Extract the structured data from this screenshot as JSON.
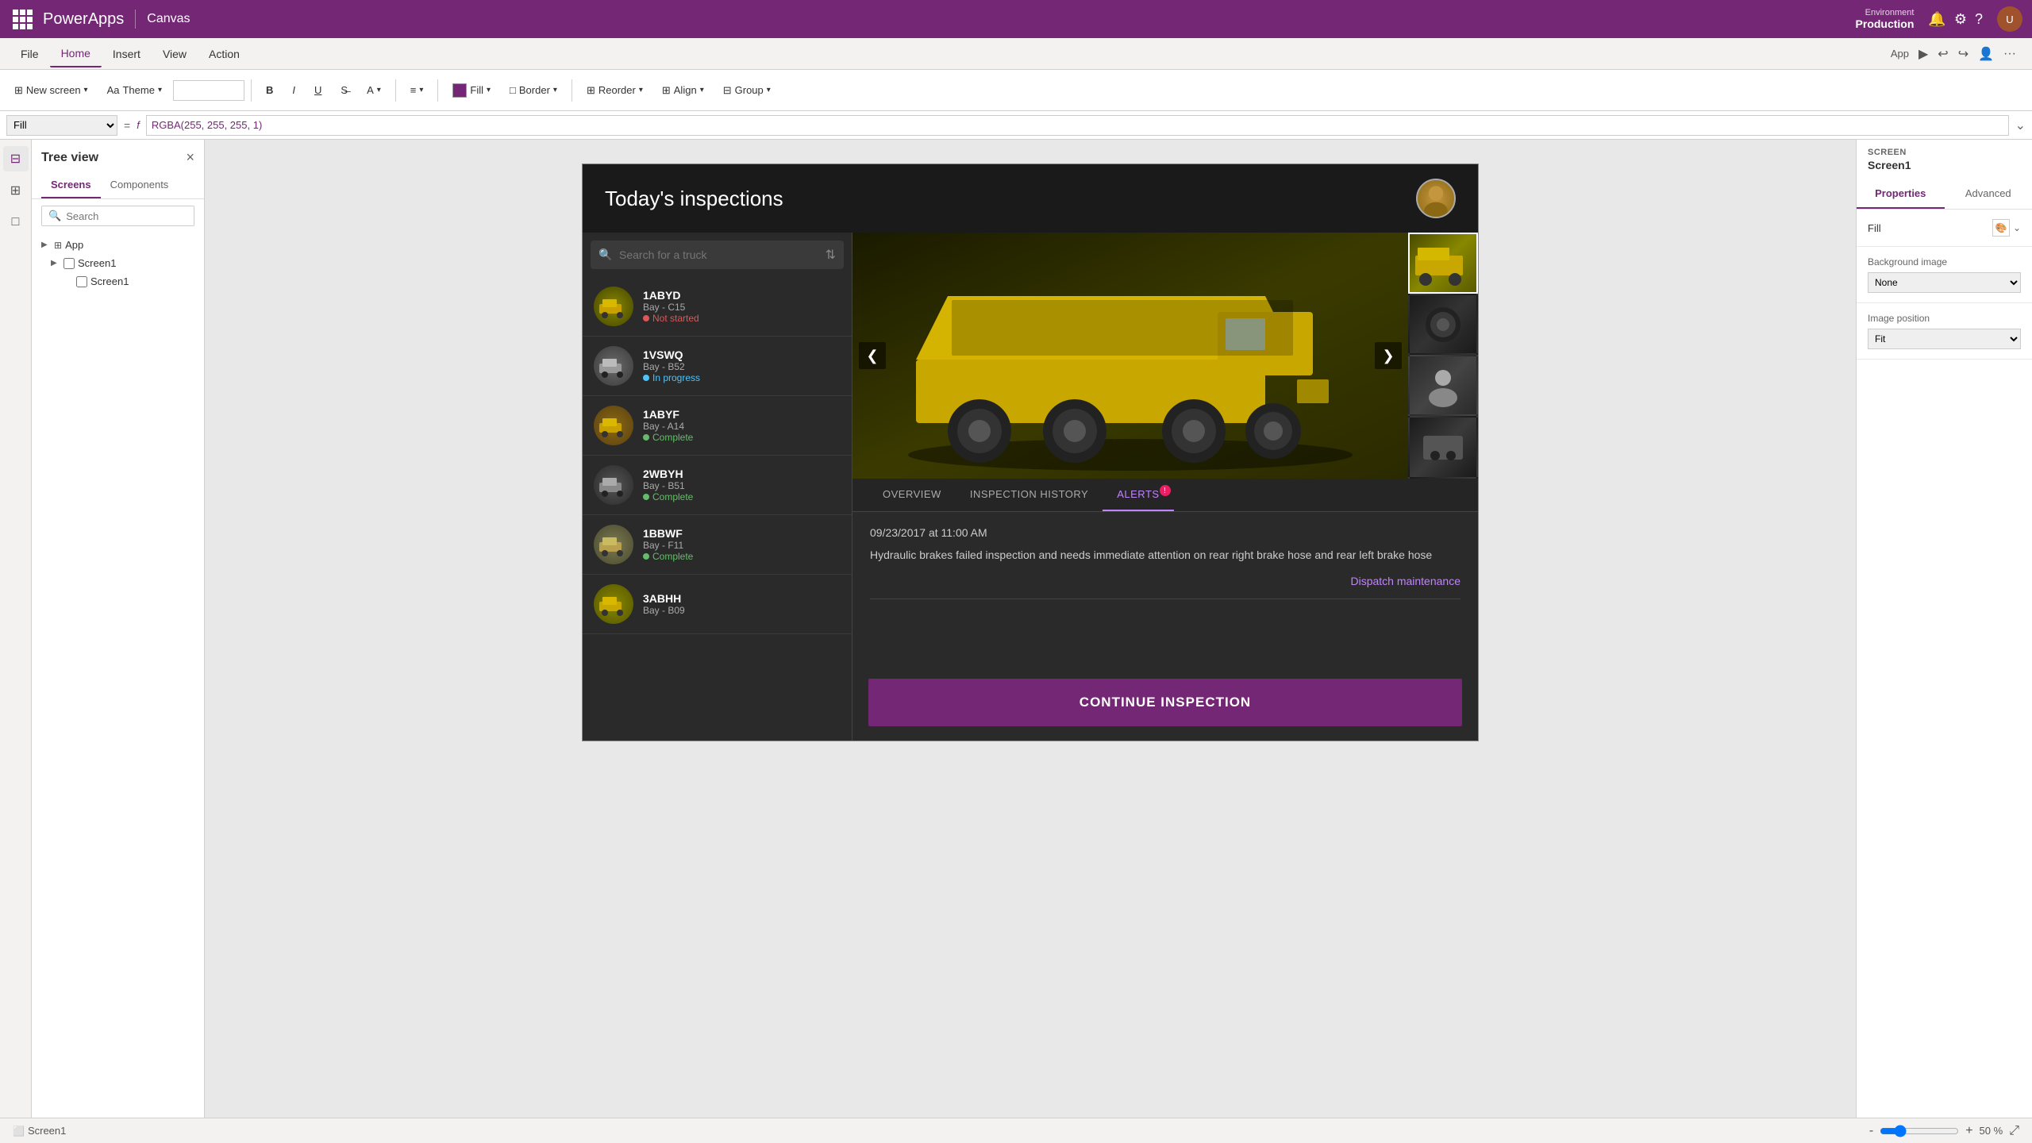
{
  "topbar": {
    "app_name": "PowerApps",
    "canvas_label": "Canvas",
    "env_label": "Environment",
    "env_name": "Production",
    "app_label": "App"
  },
  "menubar": {
    "items": [
      "File",
      "Home",
      "Insert",
      "View",
      "Action"
    ]
  },
  "toolbar": {
    "new_screen_label": "New screen",
    "theme_label": "Theme",
    "bold": "B",
    "italic": "I",
    "underline": "U",
    "fill_label": "Fill",
    "border_label": "Border",
    "reorder_label": "Reorder",
    "align_label": "Align",
    "group_label": "Group"
  },
  "formulabar": {
    "property": "Fill",
    "formula": "RGBA(255, 255, 255, 1)"
  },
  "sidebar": {
    "title": "Tree view",
    "close_label": "×",
    "tabs": [
      "Screens",
      "Components"
    ],
    "search_placeholder": "Search",
    "items": [
      {
        "label": "App",
        "type": "app",
        "level": 0
      },
      {
        "label": "Screen1",
        "type": "screen",
        "level": 1
      },
      {
        "label": "Screen1",
        "type": "screen",
        "level": 2
      }
    ]
  },
  "app": {
    "title": "Today's inspections",
    "search_placeholder": "Search for a truck",
    "tabs": [
      "OVERVIEW",
      "INSPECTION HISTORY",
      "ALERTS"
    ],
    "active_tab": "ALERTS",
    "alert_badge": "!",
    "alert_date": "09/23/2017 at 11:00 AM",
    "alert_message": "Hydraulic brakes failed inspection and needs immediate attention on rear right brake hose and rear left brake hose",
    "dispatch_link": "Dispatch maintenance",
    "continue_btn": "CONTINUE INSPECTION",
    "trucks": [
      {
        "id": "1ABYD",
        "bay": "Bay - C15",
        "status": "Not started",
        "status_type": "not-started"
      },
      {
        "id": "1VSWQ",
        "bay": "Bay - B52",
        "status": "In progress",
        "status_type": "in-progress"
      },
      {
        "id": "1ABYF",
        "bay": "Bay - A14",
        "status": "Complete",
        "status_type": "complete"
      },
      {
        "id": "2WBYH",
        "bay": "Bay - B51",
        "status": "Complete",
        "status_type": "complete"
      },
      {
        "id": "1BBWF",
        "bay": "Bay - F11",
        "status": "Complete",
        "status_type": "complete"
      },
      {
        "id": "3ABHH",
        "bay": "Bay - B09",
        "status": "",
        "status_type": ""
      }
    ]
  },
  "right_panel": {
    "screen_label": "SCREEN",
    "screen_name": "Screen1",
    "tabs": [
      "Properties",
      "Advanced"
    ],
    "properties": {
      "fill_label": "Fill",
      "bg_image_label": "Background image",
      "bg_image_value": "None",
      "image_pos_label": "Image position",
      "image_pos_value": "Fit"
    }
  },
  "statusbar": {
    "screen_name": "Screen1",
    "zoom_minus": "-",
    "zoom_plus": "+",
    "zoom_value": "50 %"
  }
}
